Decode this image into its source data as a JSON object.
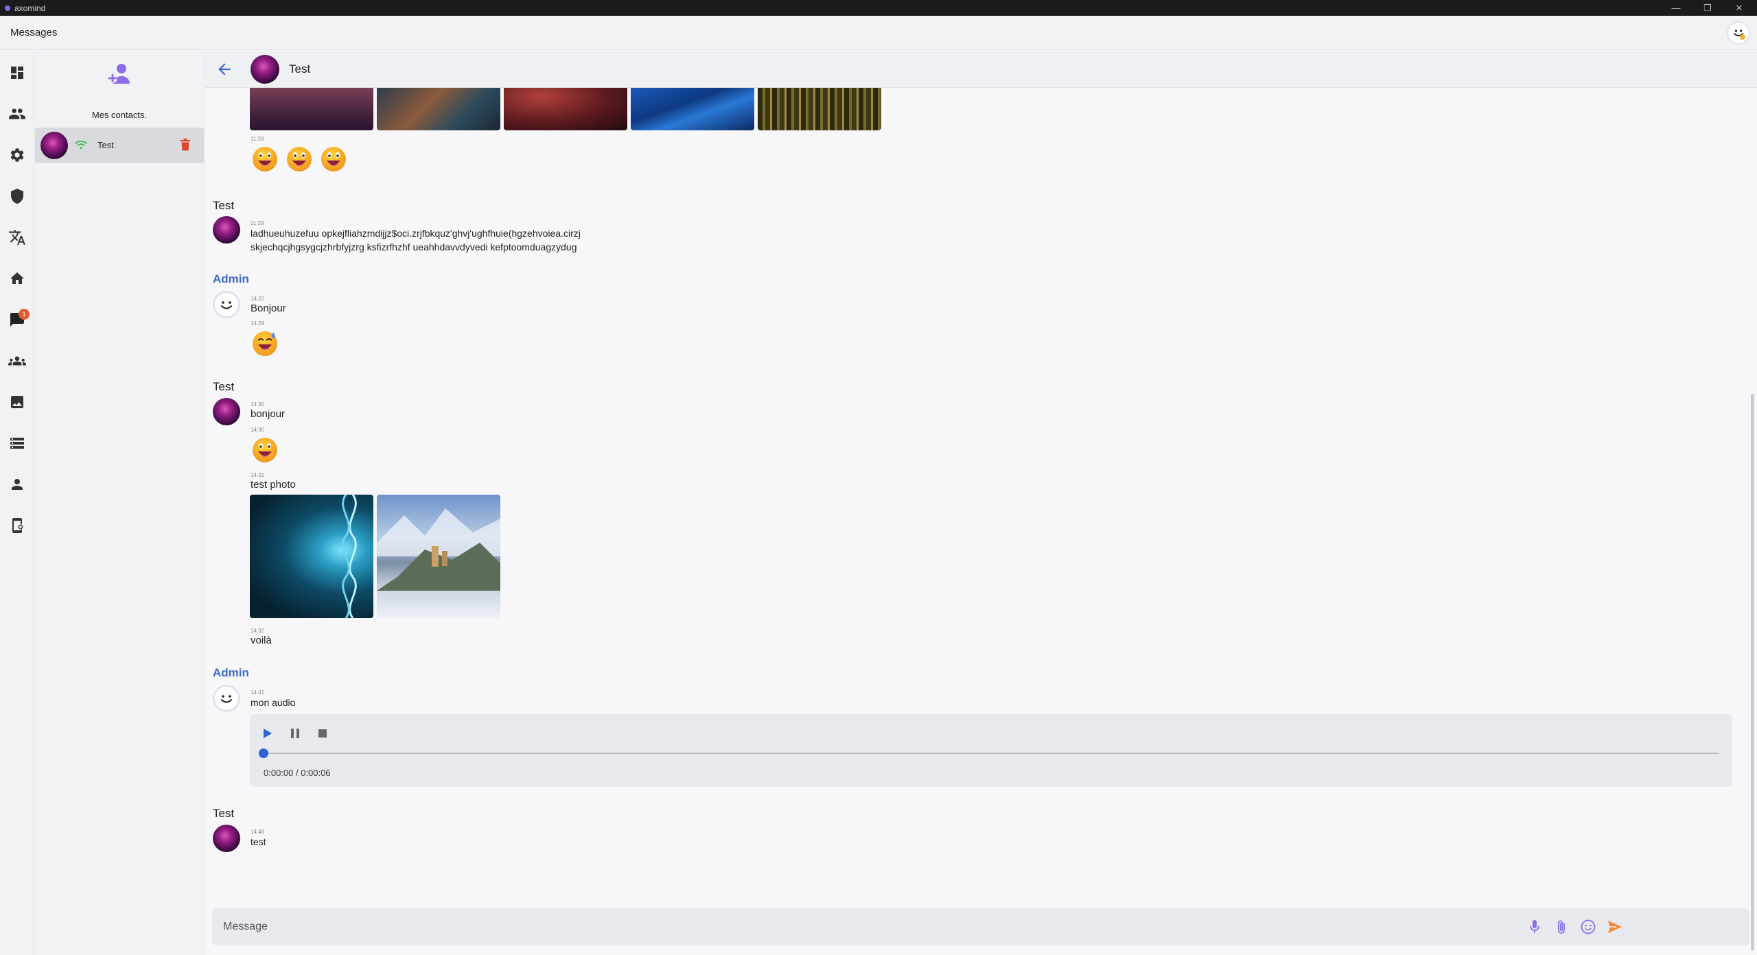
{
  "window": {
    "app_name": "axomind",
    "minimize": "—",
    "maximize": "❐",
    "close": "✕"
  },
  "header": {
    "title": "Messages"
  },
  "nav": {
    "messages_badge": "1"
  },
  "contacts": {
    "label": "Mes contacts.",
    "items": [
      {
        "name": "Test"
      }
    ]
  },
  "chat": {
    "contact_name": "Test",
    "composer_placeholder": "Message",
    "messages": [
      {
        "time": "11:28"
      },
      {
        "sender": "Test",
        "time": "11:29",
        "lines": [
          "ladhueuhuzefuu opkejfliahzmdijjz$oci.zrjfbkquz'ghvj'ughfhuie(hgzehvoiea.cirzj",
          "skjechqcjhgsygcjzhrbfyjzrg ksfizrfhzhf ueahhdavvdyvedi kefptoomduagzydug"
        ]
      },
      {
        "sender": "Admin",
        "time": "14:22",
        "text": "Bonjour"
      },
      {
        "time": "14:29"
      },
      {
        "sender": "Test",
        "time": "14:30",
        "text": "bonjour"
      },
      {
        "time": "14:30"
      },
      {
        "time": "14:31",
        "text": "test photo"
      },
      {
        "time": "14:32",
        "text": "voilà"
      },
      {
        "sender": "Admin",
        "time": "14:41",
        "text": "mon audio",
        "audio": {
          "time_label": "0:00:00 / 0:00:06",
          "progress": 0
        }
      },
      {
        "sender": "Test",
        "time": "14:48",
        "text": "test"
      }
    ]
  },
  "colors": {
    "accent": "#3a69c9",
    "badge": "#e25b2f",
    "send": "#ee8a3c",
    "icons_purple": "#8b6ee6"
  }
}
